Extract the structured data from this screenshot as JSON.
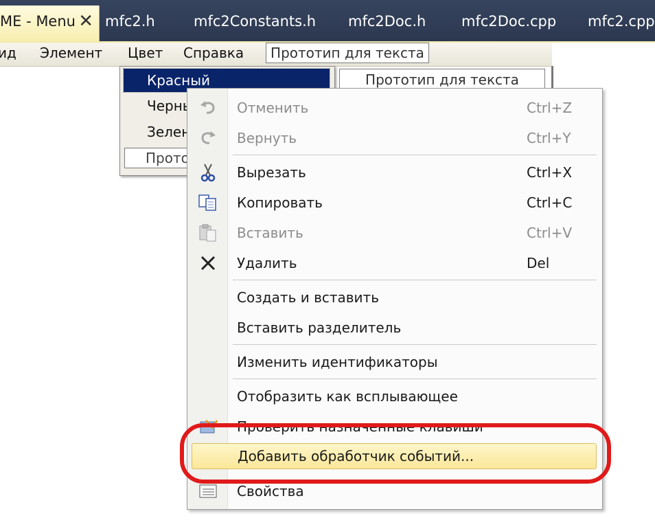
{
  "tabs": {
    "active": {
      "label": "ME - Menu",
      "close": "✕"
    },
    "items": [
      {
        "label": "mfc2.h"
      },
      {
        "label": "mfc2Constants.h"
      },
      {
        "label": "mfc2Doc.h"
      },
      {
        "label": "mfc2Doc.cpp"
      },
      {
        "label": "mfc2.cpp"
      }
    ]
  },
  "menubar": {
    "items": [
      "ид",
      "Элемент",
      "Цвет",
      "Справка"
    ],
    "prototype": "Прототип для текста"
  },
  "submenu": {
    "items": [
      "Красный",
      "Черный",
      "Зелен"
    ],
    "prototype": "Прото",
    "prototype_right": "Прототип для текста"
  },
  "context_menu": {
    "items": [
      {
        "label": "Отменить",
        "shortcut": "Ctrl+Z",
        "icon": "undo-icon",
        "enabled": false
      },
      {
        "label": "Вернуть",
        "shortcut": "Ctrl+Y",
        "icon": "redo-icon",
        "enabled": false
      },
      {
        "label": "Вырезать",
        "shortcut": "Ctrl+X",
        "icon": "scissors-icon",
        "enabled": true
      },
      {
        "label": "Копировать",
        "shortcut": "Ctrl+C",
        "icon": "copy-icon",
        "enabled": true
      },
      {
        "label": "Вставить",
        "shortcut": "Ctrl+V",
        "icon": "paste-icon",
        "enabled": false
      },
      {
        "label": "Удалить",
        "shortcut": "Del",
        "icon": "delete-icon",
        "enabled": true
      },
      {
        "label": "Создать и вставить",
        "shortcut": "",
        "enabled": true
      },
      {
        "label": "Вставить разделитель",
        "shortcut": "",
        "enabled": true
      },
      {
        "label": "Изменить идентификаторы",
        "shortcut": "",
        "enabled": true
      },
      {
        "label": "Отобразить как всплывающее",
        "shortcut": "",
        "enabled": true
      },
      {
        "label": "Проверить назначенные клавиши",
        "shortcut": "",
        "icon": "check-keys-icon",
        "enabled": true
      },
      {
        "label": "Добавить обработчик событий...",
        "shortcut": "",
        "enabled": true,
        "highlighted": true
      },
      {
        "label": "Свойства",
        "shortcut": "",
        "icon": "properties-icon",
        "enabled": true
      }
    ]
  },
  "colors": {
    "tab_bar": "#2c3850",
    "selection": "#0a246a",
    "highlight": "#fbe79a",
    "annotation": "#e01a1a"
  }
}
